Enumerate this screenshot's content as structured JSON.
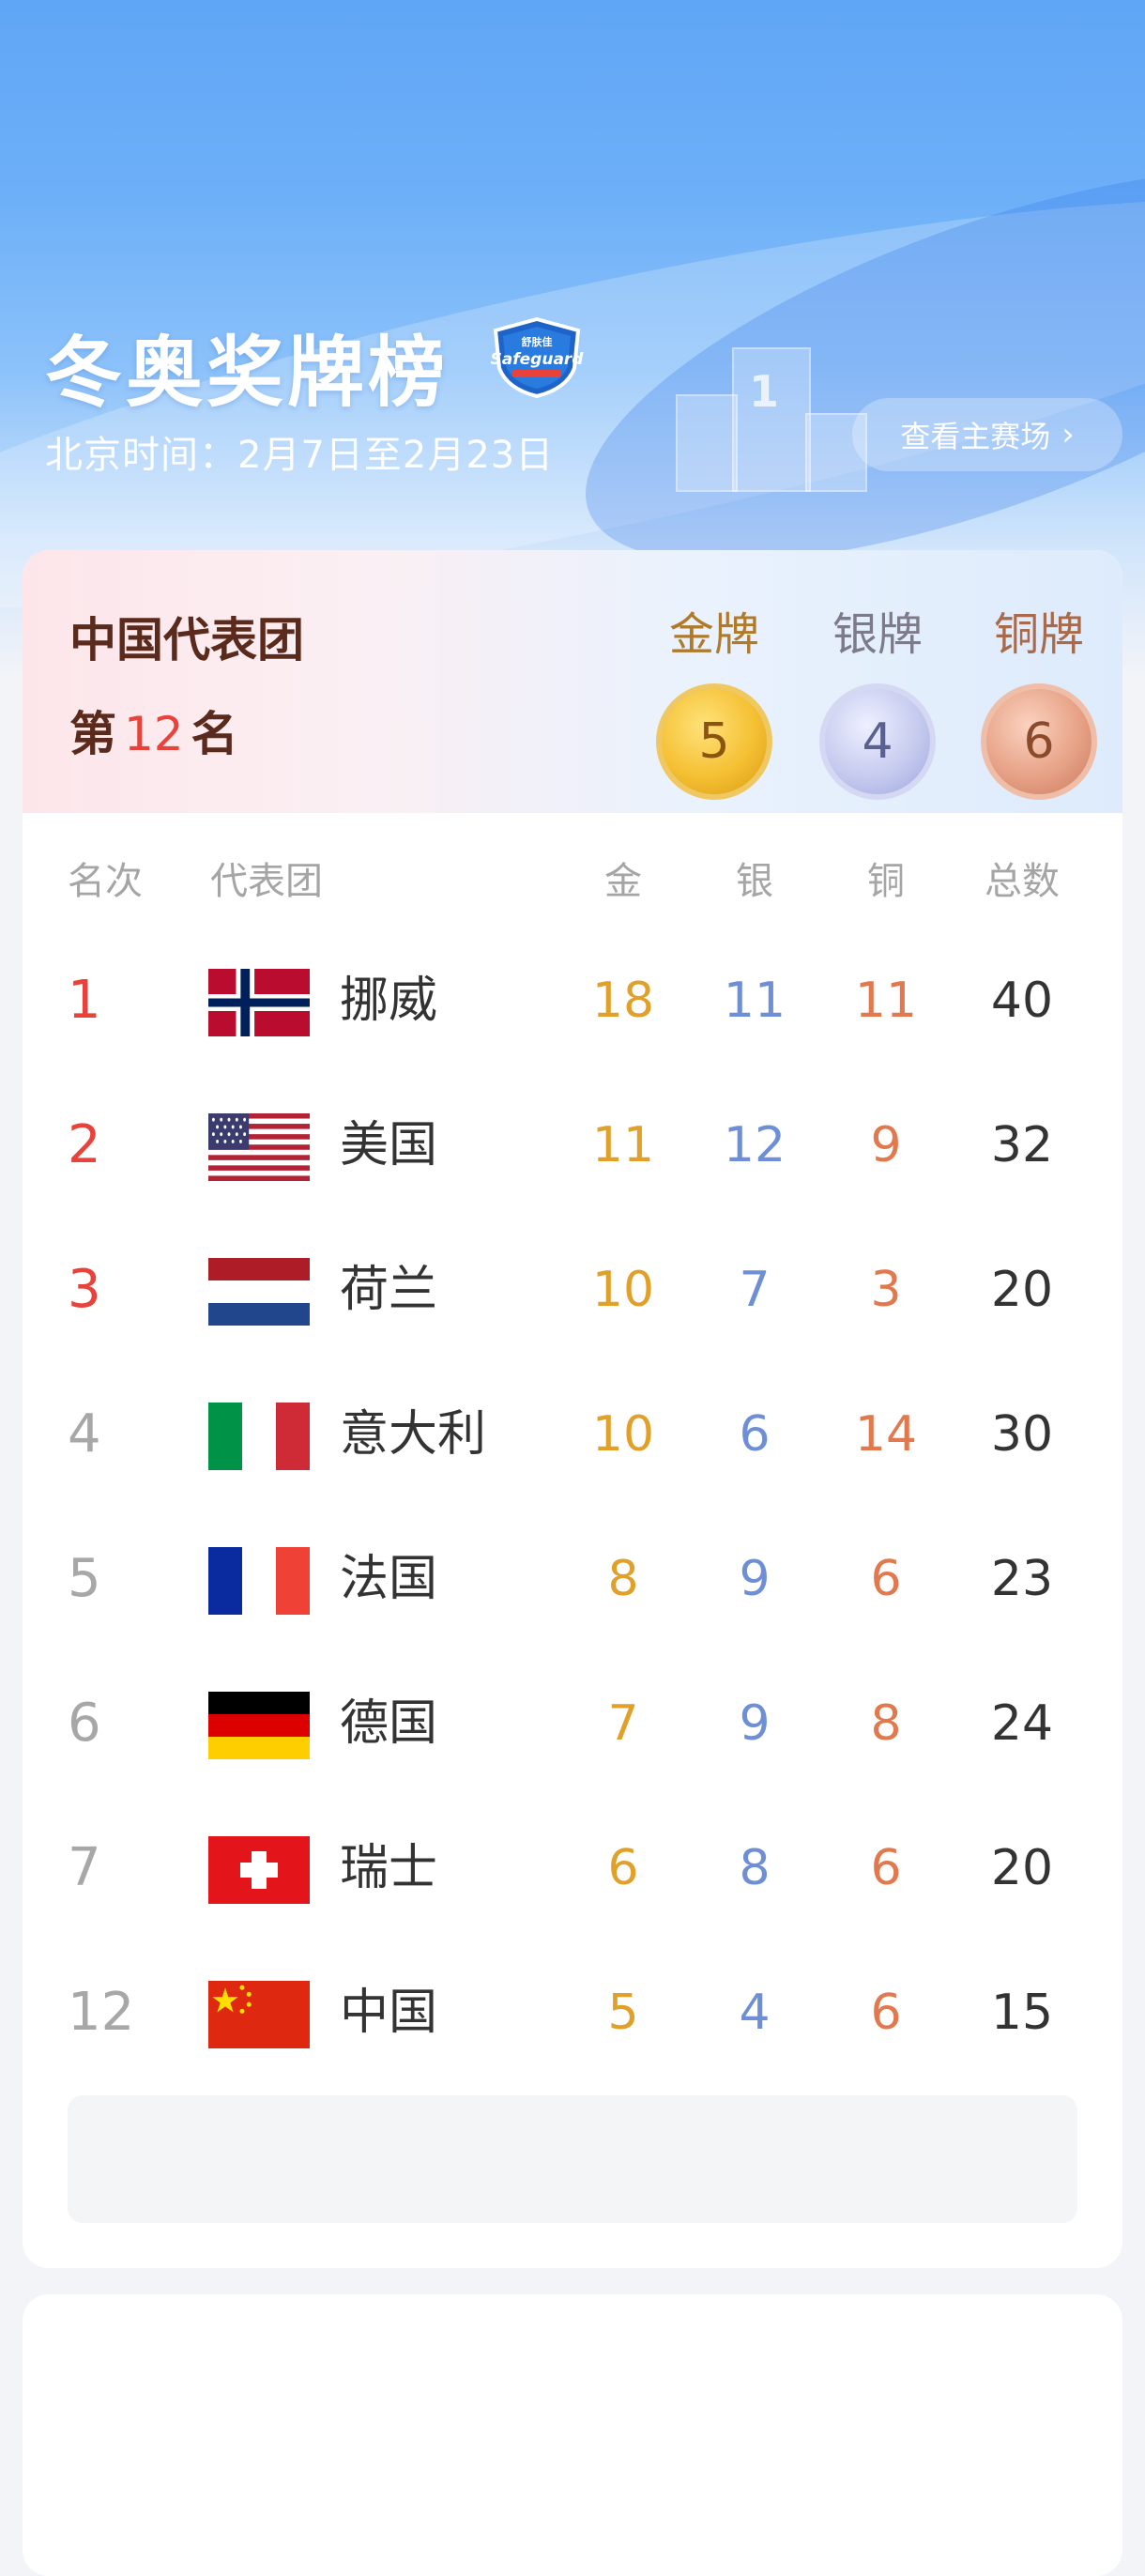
{
  "header": {
    "title": "冬奥奖牌榜",
    "date_range": "北京时间：2月7日至2月23日",
    "venue_button_label": "查看主赛场",
    "sponsor": "Safeguard",
    "sponsor_cn": "舒肤佳",
    "podium_number": "1"
  },
  "team_summary": {
    "team_name": "中国代表团",
    "rank_prefix": "第",
    "rank_number": "12",
    "rank_suffix": "名",
    "medals": [
      {
        "label": "金牌",
        "count": "5"
      },
      {
        "label": "银牌",
        "count": "4"
      },
      {
        "label": "铜牌",
        "count": "6"
      }
    ]
  },
  "table": {
    "headers": {
      "rank": "名次",
      "team": "代表团",
      "gold": "金",
      "silver": "银",
      "bronze": "铜",
      "total": "总数"
    },
    "rows": [
      {
        "rank": "1",
        "country": "挪威",
        "flag": "norway",
        "gold": "18",
        "silver": "11",
        "bronze": "11",
        "total": "40"
      },
      {
        "rank": "2",
        "country": "美国",
        "flag": "usa",
        "gold": "11",
        "silver": "12",
        "bronze": "9",
        "total": "32"
      },
      {
        "rank": "3",
        "country": "荷兰",
        "flag": "netherlands",
        "gold": "10",
        "silver": "7",
        "bronze": "3",
        "total": "20"
      },
      {
        "rank": "4",
        "country": "意大利",
        "flag": "italy",
        "gold": "10",
        "silver": "6",
        "bronze": "14",
        "total": "30"
      },
      {
        "rank": "5",
        "country": "法国",
        "flag": "france",
        "gold": "8",
        "silver": "9",
        "bronze": "6",
        "total": "23"
      },
      {
        "rank": "6",
        "country": "德国",
        "flag": "germany",
        "gold": "7",
        "silver": "9",
        "bronze": "8",
        "total": "24"
      },
      {
        "rank": "7",
        "country": "瑞士",
        "flag": "switzerland",
        "gold": "6",
        "silver": "8",
        "bronze": "6",
        "total": "20"
      },
      {
        "rank": "12",
        "country": "中国",
        "flag": "china",
        "gold": "5",
        "silver": "4",
        "bronze": "6",
        "total": "15"
      }
    ]
  },
  "colors": {
    "top_rank": "#e8423a",
    "gold_text": "#e0a02a",
    "silver_text": "#6e8fd6",
    "bronze_text": "#e1784e"
  }
}
